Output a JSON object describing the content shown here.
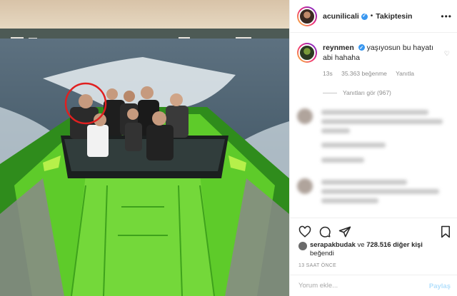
{
  "post": {
    "author": "acunilicali",
    "separator": "•",
    "follow_label": "Takiptesin",
    "more_label": "•••"
  },
  "top_comment": {
    "user": "reynmen",
    "text": "yaşıyosun bu hayatı abi hahaha",
    "time": "13s",
    "likes": "35.363 beğenme",
    "reply_label": "Yanıtla",
    "view_replies": "Yanıtları gör (967)"
  },
  "likes_line": {
    "user": "serapakbudak",
    "connector": "ve",
    "count": "728.516 diğer kişi",
    "suffix": "beğendi"
  },
  "timestamp": "13 SAAT ÖNCE",
  "comment_input": {
    "placeholder": "Yorum ekle...",
    "post_label": "Paylaş"
  },
  "icons": {
    "like": "heart-icon",
    "comment": "comment-icon",
    "share": "share-icon",
    "save": "bookmark-icon"
  },
  "colors": {
    "verified": "#3897f0",
    "boat": "#5ecb2a",
    "highlight_circle": "#e02020"
  }
}
